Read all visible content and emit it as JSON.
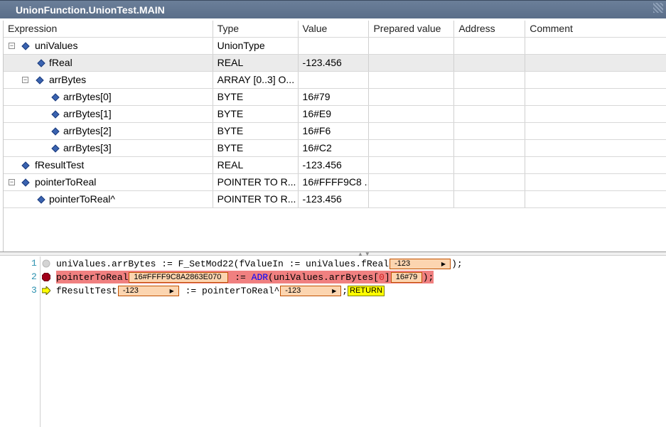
{
  "window": {
    "title": "UnionFunction.UnionTest.MAIN"
  },
  "watch": {
    "columns": [
      "Expression",
      "Type",
      "Value",
      "Prepared value",
      "Address",
      "Comment"
    ],
    "rows": [
      {
        "expr": "uniValues",
        "type": "UnionType",
        "value": "",
        "prepared": "",
        "address": "",
        "comment": ""
      },
      {
        "expr": "fReal",
        "type": "REAL",
        "value": "-123.456",
        "prepared": "",
        "address": "",
        "comment": ""
      },
      {
        "expr": "arrBytes",
        "type": "ARRAY [0..3] O...",
        "value": "",
        "prepared": "",
        "address": "",
        "comment": ""
      },
      {
        "expr": "arrBytes[0]",
        "type": "BYTE",
        "value": "16#79",
        "prepared": "",
        "address": "",
        "comment": ""
      },
      {
        "expr": "arrBytes[1]",
        "type": "BYTE",
        "value": "16#E9",
        "prepared": "",
        "address": "",
        "comment": ""
      },
      {
        "expr": "arrBytes[2]",
        "type": "BYTE",
        "value": "16#F6",
        "prepared": "",
        "address": "",
        "comment": ""
      },
      {
        "expr": "arrBytes[3]",
        "type": "BYTE",
        "value": "16#C2",
        "prepared": "",
        "address": "",
        "comment": ""
      },
      {
        "expr": "fResultTest",
        "type": "REAL",
        "value": "-123.456",
        "prepared": "",
        "address": "",
        "comment": ""
      },
      {
        "expr": "pointerToReal",
        "type": "POINTER TO R...",
        "value": "16#FFFF9C8 ...",
        "prepared": "",
        "address": "",
        "comment": ""
      },
      {
        "expr": "pointerToReal^",
        "type": "POINTER TO R...",
        "value": "-123.456",
        "prepared": "",
        "address": "",
        "comment": ""
      }
    ],
    "expander_symbol": "⊟"
  },
  "editor": {
    "line_numbers": [
      "1",
      "2",
      "3"
    ],
    "line1": {
      "a": "uniValues.arrBytes := F_SetMod22(fValueIn := uniValues.fReal",
      "inline": "-123",
      "b": ");"
    },
    "line2": {
      "a": "pointerToReal",
      "inline1": "16#FFFF9C8A2863E070",
      "b": " := ",
      "kw": "ADR",
      "c": "(uniValues.arrBytes[",
      "num": "0",
      "d": "]",
      "inline2": "16#79",
      "e": ");"
    },
    "line3": {
      "a": "fResultTest",
      "inline1": "-123",
      "b": " := pointerToReal^",
      "inline2": "-123",
      "c": ";",
      "ret": "RETURN"
    },
    "colors": {
      "breakpoint_line": "#f08080",
      "inline_bg": "#fcd5b0",
      "keyword": "#0000ff",
      "return_bg": "#ffff00"
    }
  }
}
